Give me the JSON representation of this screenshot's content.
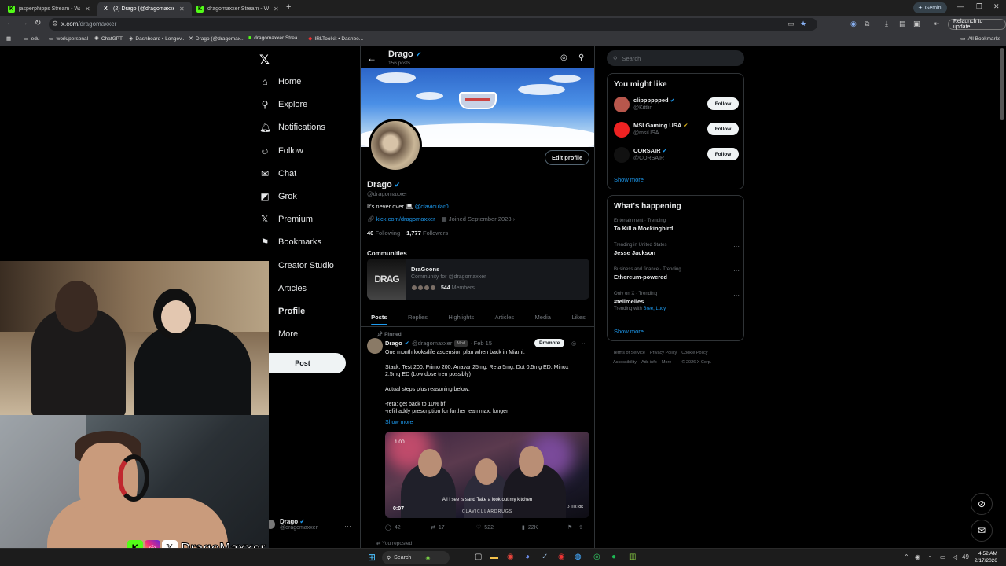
{
  "browser": {
    "tabs": [
      {
        "label": "jasperphipps Stream - Watch L",
        "favicon": "K",
        "active": false
      },
      {
        "label": "(2) Drago (@dragomaxxer) / X",
        "favicon": "X",
        "active": true
      },
      {
        "label": "dragomaxxer Stream - Watch L",
        "favicon": "K",
        "active": false
      }
    ],
    "new_tab": "+",
    "gemini_label": "Gemini",
    "url_host": "x.com",
    "url_path": "/dragomaxxer",
    "relaunch_label": "Relaunch to update",
    "bookmarks": [
      {
        "icon": "folder-icon",
        "label": "edu"
      },
      {
        "icon": "folder-icon",
        "label": "work/personal"
      },
      {
        "icon": "chatgpt-icon",
        "label": "ChatGPT"
      },
      {
        "icon": "dashboard-icon",
        "label": "Dashboard • Longev..."
      },
      {
        "icon": "x-icon",
        "label": "Drago (@dragomax..."
      },
      {
        "icon": "kick-icon",
        "label": "dragomaxxer Strea..."
      },
      {
        "icon": "toolkit-icon",
        "label": "IRLToolkit • Dashbo..."
      }
    ],
    "all_bookmarks": "All Bookmarks"
  },
  "nav": {
    "items": [
      {
        "label": "Home",
        "icon": "home-icon",
        "glyph": "⌂",
        "dot": false
      },
      {
        "label": "Explore",
        "icon": "search-icon",
        "glyph": "⚲",
        "dot": false
      },
      {
        "label": "Notifications",
        "icon": "bell-icon",
        "glyph": "🔔︎",
        "dot": true
      },
      {
        "label": "Follow",
        "icon": "add-user-icon",
        "glyph": "☺",
        "dot": false
      },
      {
        "label": "Chat",
        "icon": "mail-icon",
        "glyph": "✉",
        "dot": true
      },
      {
        "label": "Grok",
        "icon": "grok-icon",
        "glyph": "◩",
        "dot": false
      },
      {
        "label": "Premium",
        "icon": "x-premium-icon",
        "glyph": "𝕏",
        "dot": false
      },
      {
        "label": "Bookmarks",
        "icon": "bookmark-icon",
        "glyph": "⚑",
        "dot": false
      },
      {
        "label": "Creator Studio",
        "icon": "studio-icon",
        "glyph": "▤",
        "dot": false
      },
      {
        "label": "Articles",
        "icon": "articles-icon",
        "glyph": "▥",
        "dot": false
      },
      {
        "label": "Profile",
        "icon": "profile-icon",
        "glyph": "☻",
        "dot": false
      },
      {
        "label": "More",
        "icon": "more-icon",
        "glyph": "⋯",
        "dot": false
      }
    ],
    "post_label": "Post",
    "account_name": "Drago",
    "account_handle": "@dragomaxxer"
  },
  "overlay": {
    "brand": "DragoMaxxer"
  },
  "header": {
    "name": "Drago",
    "posts": "156 posts"
  },
  "profile": {
    "edit_label": "Edit profile",
    "name": "Drago",
    "handle": "@dragomaxxer",
    "bio_text": "It's never over",
    "bio_link": "@clavicular0",
    "website": "kick.com/dragomaxxer",
    "joined": "Joined September 2023",
    "following_count": "40",
    "following_label": "Following",
    "followers_count": "1,777",
    "followers_label": "Followers"
  },
  "communities": {
    "title": "Communities",
    "name": "DraGoons",
    "desc": "Community for @dragomaxxer",
    "members": "544",
    "members_label": "Members",
    "thumb_text": "DRAG"
  },
  "tabs": [
    "Posts",
    "Replies",
    "Highlights",
    "Articles",
    "Media",
    "Likes"
  ],
  "tweet": {
    "pinned": "Pinned",
    "name": "Drago",
    "handle": "@dragomaxxer",
    "badge": "Mod",
    "date": "· Feb 15",
    "promote": "Promote",
    "lines": [
      "One month looks/life ascension plan when back in Miami:",
      "",
      "Stack: Test 200, Primo 200, Anavar 25mg, Reta 5mg, Dut 0.5mg ED, Minox",
      "2.5mg ED (Low dose tren possibly)",
      "",
      "Actual steps plus reasoning below:",
      "",
      "-reta: get back to 10% bf",
      "-refill addy prescription for further lean max, longer"
    ],
    "show_more": "Show more",
    "video_time": "1:00",
    "video_caption": "All I see is sand Take a look out my kitchen",
    "video_watermark": "CLAVICULARDRUGS",
    "video_duration": "0:07",
    "video_tiktok": "TikTok",
    "replies": "42",
    "reposts": "17",
    "likes": "522",
    "views": "22K",
    "reposted_label": "You reposted"
  },
  "right": {
    "search_placeholder": "Search",
    "might_like_title": "You might like",
    "suggestions": [
      {
        "name": "clipppppped",
        "handle": "@Kittlin",
        "verified": "blue",
        "color": "#b8574c"
      },
      {
        "name": "MSI Gaming USA",
        "handle": "@msiUSA",
        "verified": "gold",
        "color": "#e22"
      },
      {
        "name": "CORSAIR",
        "handle": "@CORSAIR",
        "verified": "blue",
        "color": "#111"
      }
    ],
    "follow_label": "Follow",
    "show_more": "Show more",
    "happening_title": "What's happening",
    "trends": [
      {
        "category": "Entertainment · Trending",
        "title": "To Kill a Mockingbird",
        "with": "",
        "with_link": ""
      },
      {
        "category": "Trending in United States",
        "title": "Jesse Jackson",
        "with": "",
        "with_link": ""
      },
      {
        "category": "Business and finance · Trending",
        "title": "Ethereum-powered",
        "with": "",
        "with_link": ""
      },
      {
        "category": "Only on X · Trending",
        "title": "#tellmelies",
        "with": "Trending with",
        "with_link": "Bree, Lucy"
      }
    ],
    "footer_links": [
      "Terms of Service",
      "Privacy Policy",
      "Cookie Policy",
      "Accessibility",
      "Ads info",
      "More ···",
      "© 2026 X Corp."
    ]
  },
  "taskbar": {
    "search": "Search",
    "temp": "49",
    "time": "4:52 AM",
    "date": "2/17/2026"
  }
}
